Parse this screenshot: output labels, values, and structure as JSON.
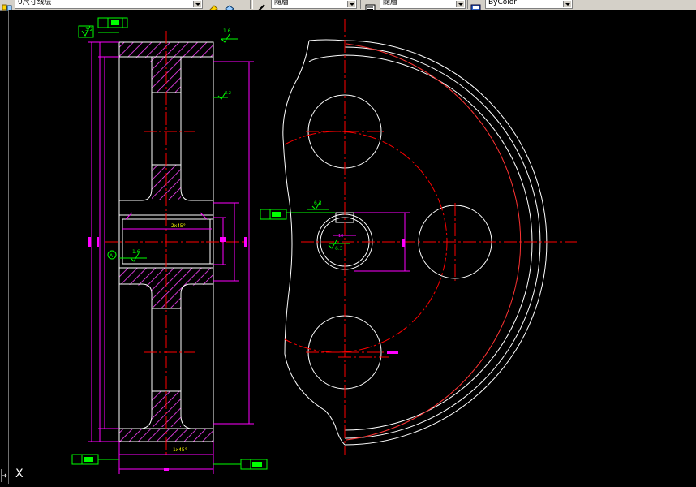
{
  "toolbar": {
    "layer_combo": {
      "value": "0尺寸线层"
    },
    "linetype_combo": {
      "value": "隨層"
    },
    "lineweight_combo": {
      "value": "隨層"
    },
    "plotstyle_combo": {
      "value": "ByColor"
    }
  },
  "drawing": {
    "surface_finish_labels": [
      "1.6",
      "3.2",
      "3.2",
      "1.6",
      "6.3",
      "6.3"
    ],
    "dimensions": {
      "keyway_chamfer": "2x45°",
      "bottom_chamfer": "1x45°",
      "keyway_width": "10",
      "tolerance_stack": "+0.036\n0",
      "datum_label": "A"
    },
    "colors": {
      "background": "#000000",
      "outline": "#ffffff",
      "centerline": "#ff0000",
      "dimension": "#ff00ff",
      "annotation": "#00ff00",
      "hatch": "#ff44ff"
    }
  },
  "ucs": {
    "label": "X"
  }
}
